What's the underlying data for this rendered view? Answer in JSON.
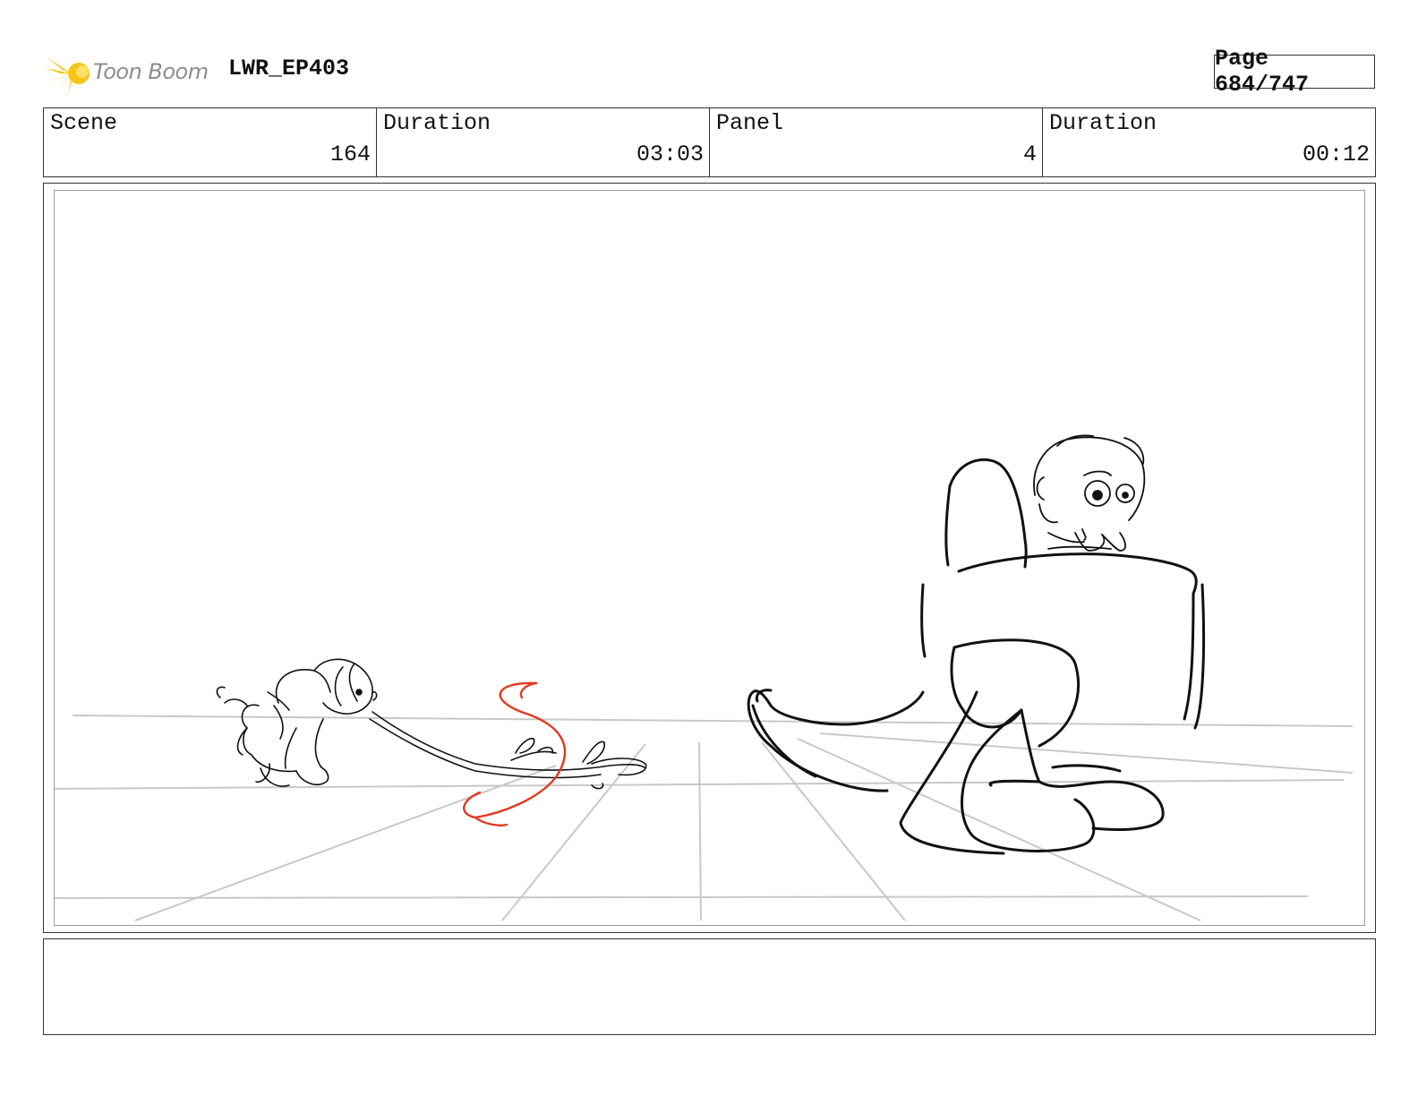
{
  "header": {
    "logo_text": "Toon Boom",
    "project": "LWR_EP403",
    "page": "Page 684/747"
  },
  "info": {
    "scene_label": "Scene",
    "scene_value": "164",
    "scene_duration_label": "Duration",
    "scene_duration_value": "03:03",
    "panel_label": "Panel",
    "panel_value": "4",
    "panel_duration_label": "Duration",
    "panel_duration_value": "00:12"
  },
  "colors": {
    "logo_yellow": "#f5c518",
    "sketch_black": "#111111",
    "guide_gray": "#c8c8c8",
    "action_red": "#e03a1e"
  },
  "notes": {
    "text": ""
  }
}
